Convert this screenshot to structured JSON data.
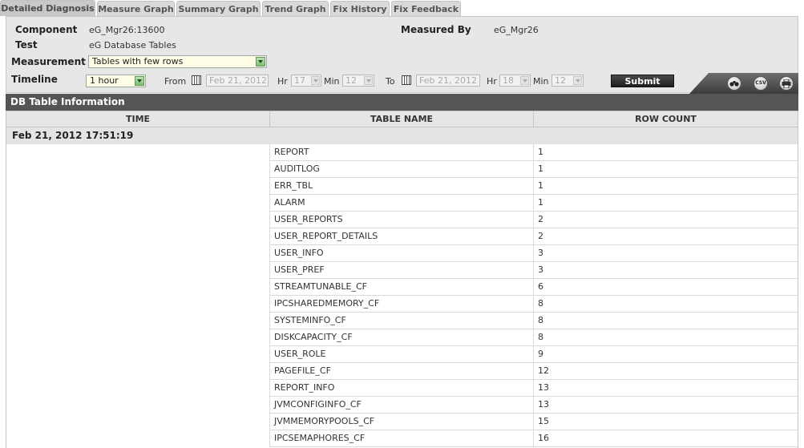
{
  "tabs": [
    "Detailed Diagnosis",
    "Measure Graph",
    "Summary Graph",
    "Trend Graph",
    "Fix History",
    "Fix Feedback"
  ],
  "form": {
    "component_label": "Component",
    "component_value": "eG_Mgr26:13600",
    "measured_by_label": "Measured By",
    "measured_by_value": "eG_Mgr26",
    "test_label": "Test",
    "test_value": "eG Database Tables",
    "measurement_label": "Measurement",
    "measurement_value": "Tables with few rows",
    "timeline_label": "Timeline",
    "timeline_value": "1 hour",
    "from_label": "From",
    "from_date": "Feb 21, 2012",
    "from_hr": "17",
    "from_min": "12",
    "to_label": "To",
    "to_date": "Feb 21, 2012",
    "to_hr": "18",
    "to_min": "12",
    "hr_label": "Hr",
    "min_label": "Min",
    "submit_label": "Submit",
    "csv_label": "CSV"
  },
  "table": {
    "title": "DB Table Information",
    "columns": [
      "TIME",
      "TABLE NAME",
      "ROW COUNT"
    ],
    "group_time": "Feb 21, 2012 17:51:19",
    "rows": [
      {
        "name": "REPORT",
        "count": "1"
      },
      {
        "name": "AUDITLOG",
        "count": "1"
      },
      {
        "name": "ERR_TBL",
        "count": "1"
      },
      {
        "name": "ALARM",
        "count": "1"
      },
      {
        "name": "USER_REPORTS",
        "count": "2"
      },
      {
        "name": "USER_REPORT_DETAILS",
        "count": "2"
      },
      {
        "name": "USER_INFO",
        "count": "3"
      },
      {
        "name": "USER_PREF",
        "count": "3"
      },
      {
        "name": "STREAMTUNABLE_CF",
        "count": "6"
      },
      {
        "name": "IPCSHAREDMEMORY_CF",
        "count": "8"
      },
      {
        "name": "SYSTEMINFO_CF",
        "count": "8"
      },
      {
        "name": "DISKCAPACITY_CF",
        "count": "8"
      },
      {
        "name": "USER_ROLE",
        "count": "9"
      },
      {
        "name": "PAGEFILE_CF",
        "count": "12"
      },
      {
        "name": "REPORT_INFO",
        "count": "13"
      },
      {
        "name": "JVMCONFIGINFO_CF",
        "count": "13"
      },
      {
        "name": "JVMMEMORYPOOLS_CF",
        "count": "15"
      },
      {
        "name": "IPCSEMAPHORES_CF",
        "count": "16"
      }
    ]
  }
}
